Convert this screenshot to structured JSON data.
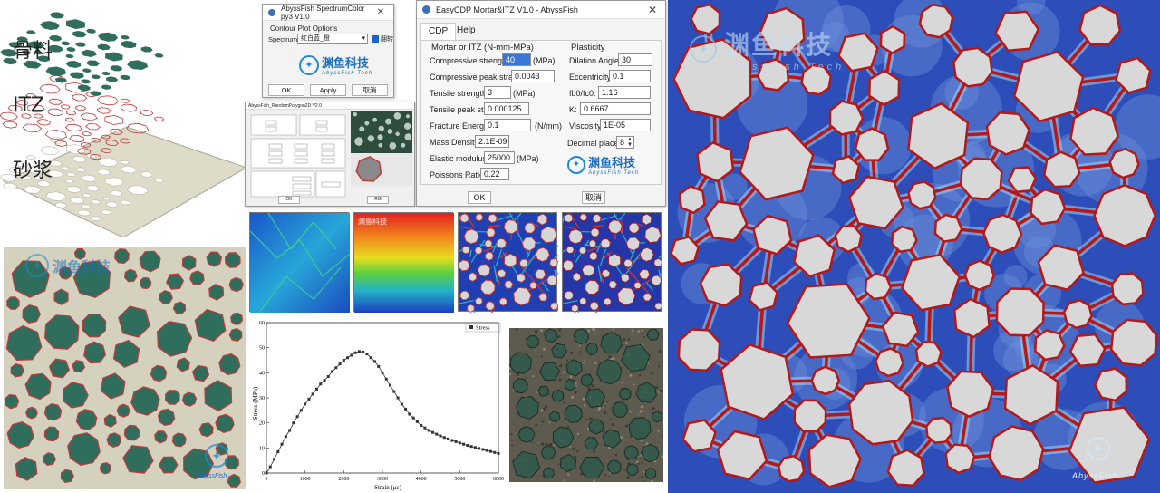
{
  "layers": {
    "aggregate_label": "骨料",
    "itz_label": "ITZ",
    "mortar_label": "砂浆"
  },
  "spectrum_window": {
    "title": "AbyssFish SpectrumColor py3 V1.0",
    "group_title": "Contour Plot Options",
    "spectrum_label": "Spectrum:",
    "spectrum_value": "红白蓝_橙",
    "reverse_label": "翻转",
    "logo_cn": "渊鱼科技",
    "logo_en": "AbyssFish Tech",
    "ok": "OK",
    "apply": "Apply",
    "cancel": "取消"
  },
  "mortar_window": {
    "title": "EasyCDP Mortar&ITZ V1.0 - AbyssFish",
    "tabs": [
      "CDP",
      "Help"
    ],
    "left_group_title": "Mortar or ITZ (N-mm-MPa)",
    "right_group_title": "Plasticity",
    "fields": [
      {
        "label": "Compressive strength:",
        "value": "40",
        "unit": "(MPa)"
      },
      {
        "label": "Compressive peak strain:",
        "value": "0.0043",
        "unit": ""
      },
      {
        "label": "Tensile strength:",
        "value": "3",
        "unit": "(MPa)"
      },
      {
        "label": "Tensile peak strain:",
        "value": "0.000125",
        "unit": ""
      },
      {
        "label": "Fracture Energy:",
        "value": "0.1",
        "unit": "(N/mm)"
      },
      {
        "label": "Mass Density:",
        "value": "2.1E-09",
        "unit": ""
      },
      {
        "label": "Elastic modulus:",
        "value": "25000",
        "unit": "(MPa)"
      },
      {
        "label": "Poissons Ratio:",
        "value": "0.22",
        "unit": ""
      }
    ],
    "plasticity": [
      {
        "label": "Dilation Angle:",
        "value": "30"
      },
      {
        "label": "Eccentricity:",
        "value": "0.1"
      },
      {
        "label": "fb0/fc0:",
        "value": "1.16"
      },
      {
        "label": "K:",
        "value": "0.6667"
      },
      {
        "label": "Viscosity:",
        "value": "1E-05"
      }
    ],
    "decimal_label": "Decimal places",
    "decimal_value": "8",
    "logo_cn": "渊鱼科技",
    "logo_en": "AbyssFish Tech",
    "ok": "OK",
    "cancel": "取消"
  },
  "mini_window": {
    "title": "AbyssFish_RandomPolygon2D V2.0",
    "ok": "OK",
    "run": "RG"
  },
  "watermark": {
    "cn": "渊鱼科技",
    "en": "AbyssFish Tech",
    "abyss": "AbyssFish"
  },
  "chart_data": {
    "type": "line",
    "series": [
      {
        "name": "Stress",
        "x": [
          0,
          100,
          200,
          300,
          400,
          500,
          600,
          700,
          800,
          900,
          1000,
          1100,
          1200,
          1300,
          1400,
          1500,
          1600,
          1700,
          1800,
          1900,
          2000,
          2100,
          2200,
          2300,
          2400,
          2500,
          2600,
          2700,
          2800,
          2900,
          3000,
          3100,
          3200,
          3300,
          3400,
          3500,
          3600,
          3700,
          3800,
          3900,
          4000,
          4100,
          4200,
          4300,
          4400,
          4500,
          4600,
          4700,
          4800,
          4900,
          5000,
          5100,
          5200,
          5300,
          5400,
          5500,
          5600,
          5700,
          5800,
          5900,
          6000
        ],
        "y": [
          0,
          2.5,
          5.5,
          8.5,
          11.5,
          14.5,
          17,
          20,
          22.5,
          25,
          27.5,
          29.5,
          31.5,
          33.5,
          35.5,
          37,
          38.5,
          40.5,
          42,
          43.5,
          45,
          46,
          47,
          48,
          48.5,
          48.3,
          47.5,
          46,
          44.5,
          42.5,
          40,
          37.5,
          35,
          32.5,
          30,
          27.5,
          25.5,
          23.5,
          22,
          20.5,
          19,
          18,
          17,
          16.2,
          15.5,
          14.8,
          14.2,
          13.6,
          13,
          12.5,
          12,
          11.5,
          11,
          10.6,
          10.2,
          9.8,
          9.4,
          9,
          8.6,
          8.2,
          7.8
        ]
      }
    ],
    "xlabel": "Strain (με)",
    "ylabel": "Stress (MPa)",
    "xlim": [
      0,
      6000
    ],
    "ylim": [
      0,
      60
    ],
    "x_ticks": [
      0,
      1000,
      2000,
      3000,
      4000,
      5000,
      6000
    ],
    "y_ticks": [
      0,
      10,
      20,
      30,
      40,
      50,
      60
    ],
    "legend": "top-right",
    "legend_label": "Stress"
  }
}
